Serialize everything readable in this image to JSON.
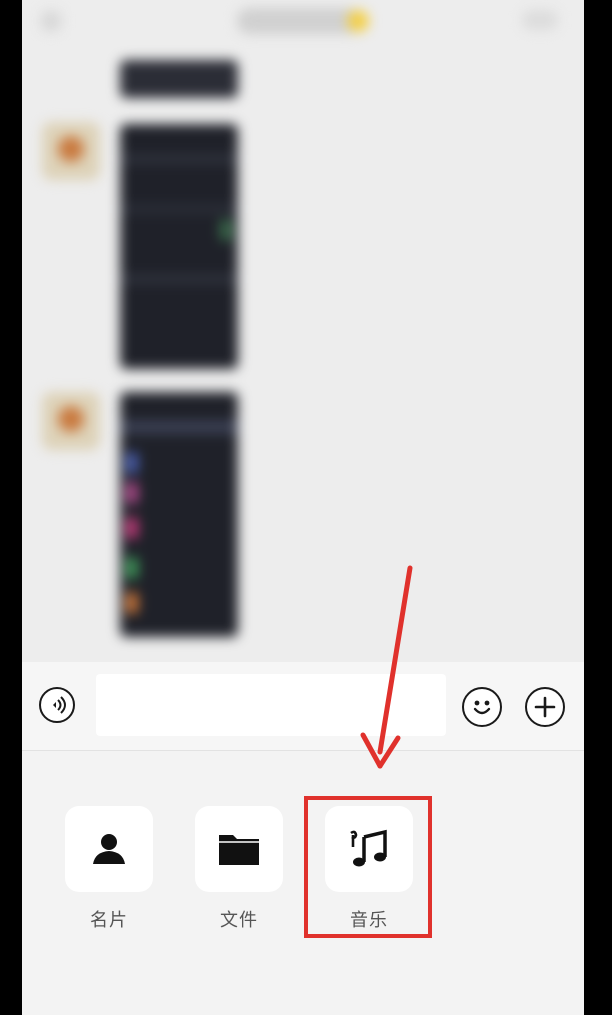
{
  "input_bar": {
    "message_placeholder": ""
  },
  "actions": [
    {
      "label": "名片",
      "icon": "contact-card-icon"
    },
    {
      "label": "文件",
      "icon": "folder-icon"
    },
    {
      "label": "音乐",
      "icon": "music-note-icon"
    }
  ],
  "icons": {
    "voice": "voice-icon",
    "emoji": "emoji-icon",
    "add": "plus-circle-icon"
  },
  "colors": {
    "annotation": "#e0312c",
    "panel_background": "#f3f3f3",
    "tile_background": "#ffffff"
  }
}
